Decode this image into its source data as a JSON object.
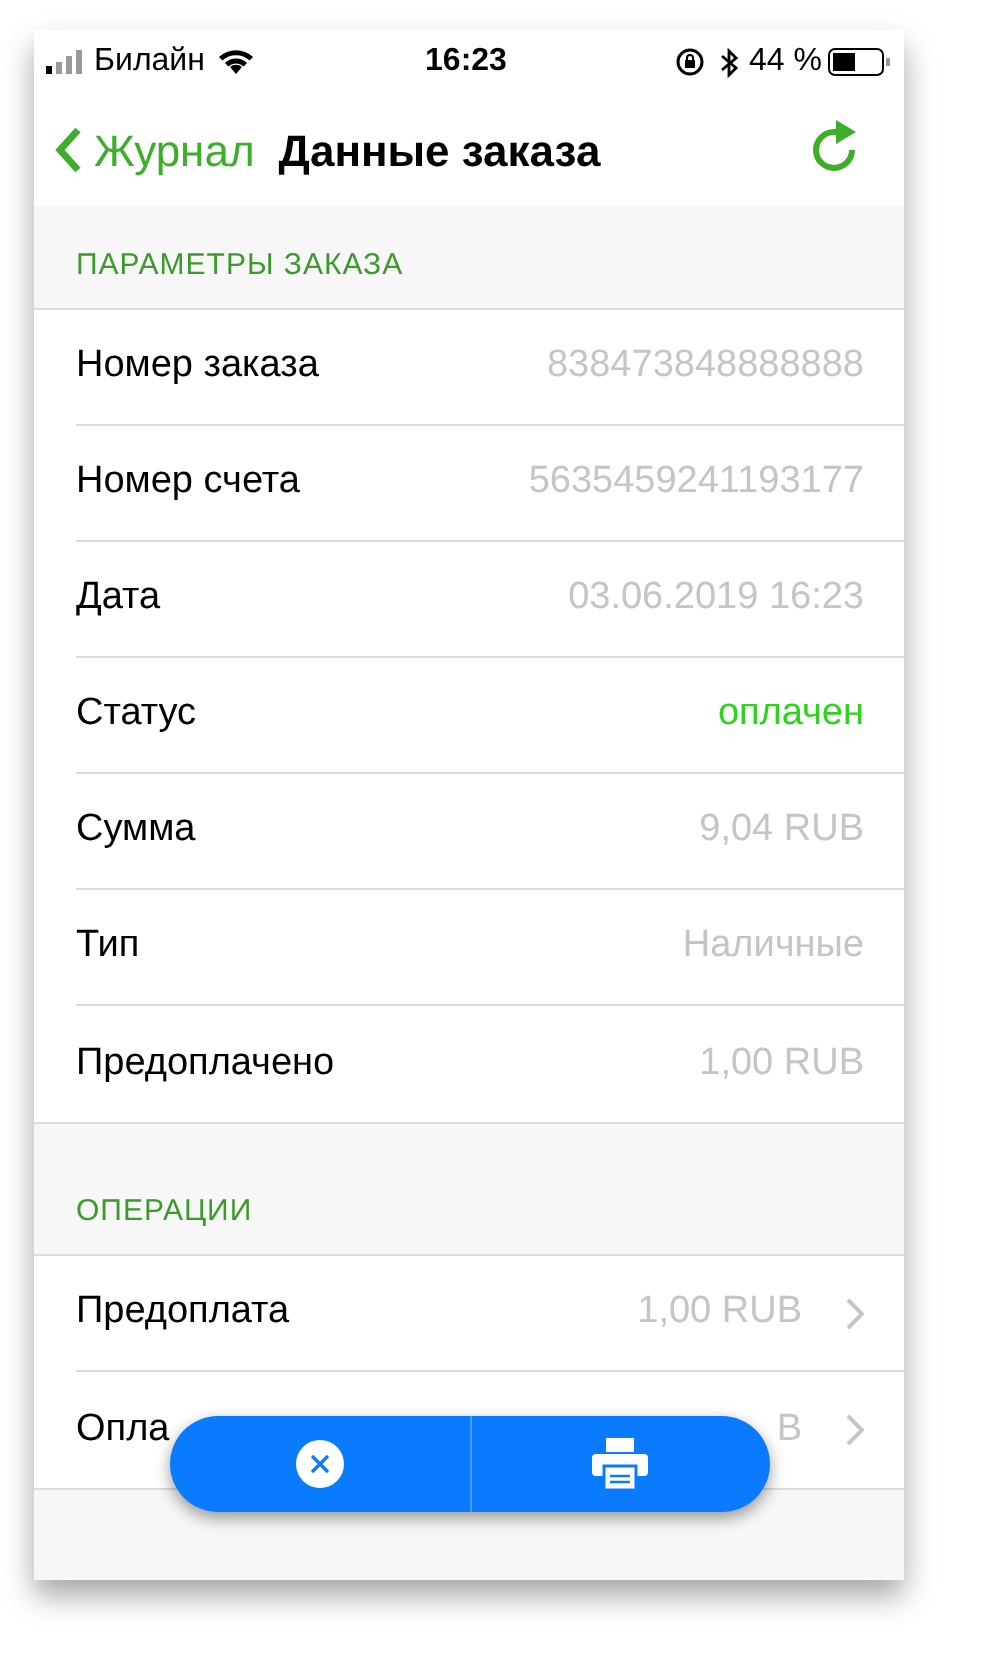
{
  "status_bar": {
    "carrier": "Билайн",
    "time": "16:23",
    "battery": "44 %"
  },
  "nav": {
    "back": "Журнал",
    "title": "Данные заказа"
  },
  "sections": [
    {
      "header": "ПАРАМЕТРЫ ЗАКАЗА",
      "rows": [
        {
          "kind": "plain",
          "label": "Номер заказа",
          "value": "838473848888888"
        },
        {
          "kind": "plain",
          "label": "Номер счета",
          "value": "5635459241193177"
        },
        {
          "kind": "plain",
          "label": "Дата",
          "value": "03.06.2019 16:23"
        },
        {
          "kind": "status",
          "label": "Статус",
          "value": "оплачен"
        },
        {
          "kind": "plain",
          "label": "Сумма",
          "value": "9,04 RUB"
        },
        {
          "kind": "plain",
          "label": "Тип",
          "value": "Наличные"
        },
        {
          "kind": "plain",
          "label": "Предоплачено",
          "value": "1,00 RUB"
        }
      ]
    },
    {
      "header": "ОПЕРАЦИИ",
      "rows": [
        {
          "kind": "link",
          "label": "Предоплата",
          "value": "1,00 RUB"
        },
        {
          "kind": "link",
          "label": "Опла",
          "value": "B"
        }
      ]
    }
  ]
}
